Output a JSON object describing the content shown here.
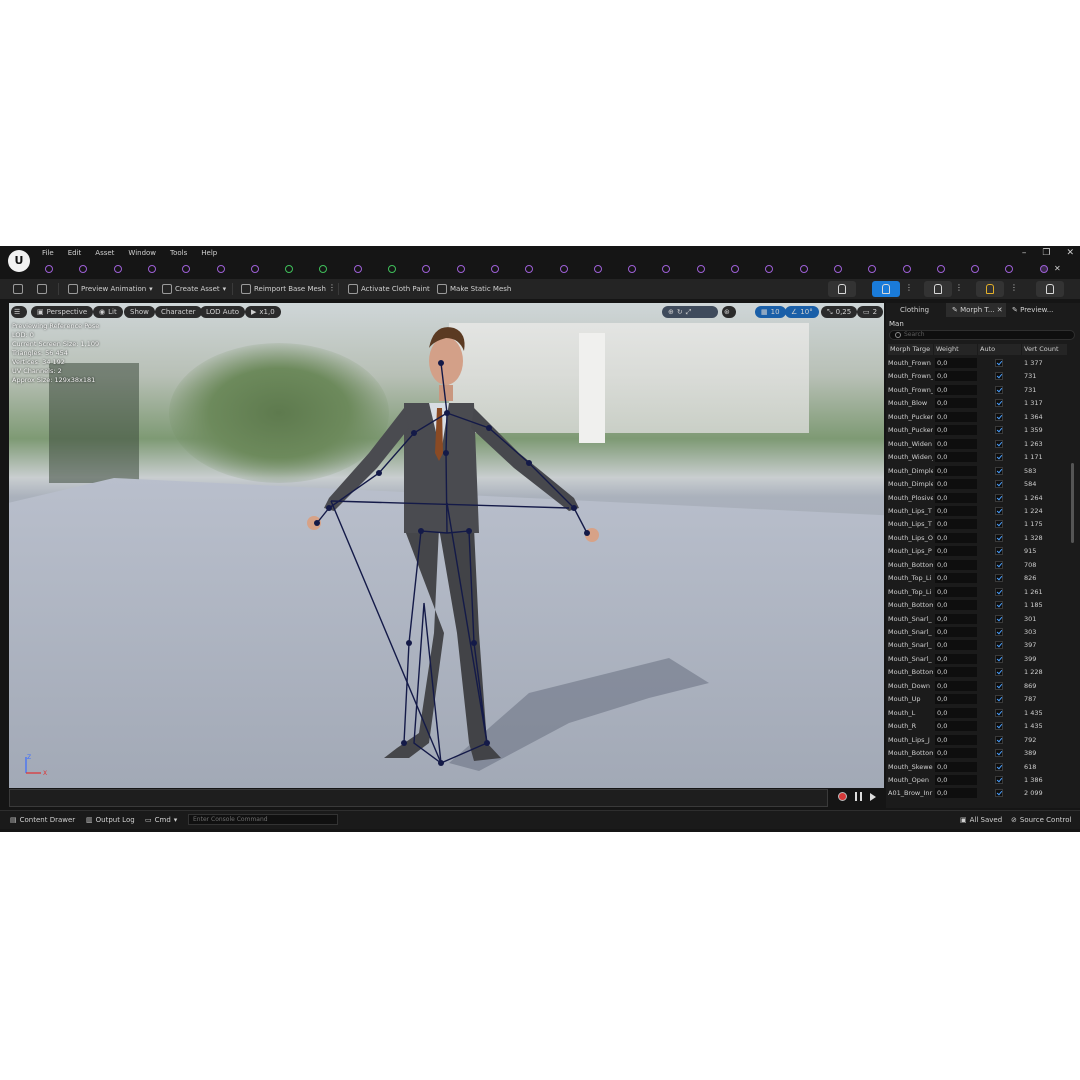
{
  "menu": {
    "items": [
      "File",
      "Edit",
      "Asset",
      "Window",
      "Tools",
      "Help"
    ]
  },
  "window_controls": {
    "minimize": "–",
    "maximize": "❐",
    "close": "✕"
  },
  "toolbar": {
    "preview_animation": "Preview Animation",
    "create_asset": "Create Asset",
    "reimport_base_mesh": "Reimport Base Mesh",
    "activate_cloth_paint": "Activate Cloth Paint",
    "make_static_mesh": "Make Static Mesh",
    "accent_color": "#1a7bd9"
  },
  "viewport": {
    "perspective": "Perspective",
    "lit": "Lit",
    "show": "Show",
    "character": "Character",
    "lod_auto": "LOD Auto",
    "play_rate": "x1,0",
    "grid_snap": "10",
    "rot_snap": "10°",
    "scale_snap": "0,25",
    "camera_speed": "2",
    "stats": [
      "Previewing Reference Pose",
      "LOD: 0",
      "Current Screen Size: 1,109",
      "Triangles: 56 454",
      "Vertices: 34 192",
      "UV Channels: 2",
      "Approx Size: 129x38x181"
    ],
    "axis_z": "Z",
    "axis_x": "X"
  },
  "statusbar": {
    "content_drawer": "Content Drawer",
    "output_log": "Output Log",
    "cmd": "Cmd",
    "console_placeholder": "Enter Console Command",
    "all_saved": "All Saved",
    "source_control": "Source Control"
  },
  "panel": {
    "tabs": [
      "Clothing",
      "Morph T...",
      "Preview..."
    ],
    "asset_name": "Man",
    "search_placeholder": "Search",
    "columns": [
      "Morph Targe",
      "Weight",
      "Auto",
      "Vert Count"
    ],
    "rows": [
      {
        "name": "Mouth_Frown",
        "weight": "0,0",
        "vert": "1 377"
      },
      {
        "name": "Mouth_Frown_",
        "weight": "0,0",
        "vert": "731"
      },
      {
        "name": "Mouth_Frown_",
        "weight": "0,0",
        "vert": "731"
      },
      {
        "name": "Mouth_Blow",
        "weight": "0,0",
        "vert": "1 317"
      },
      {
        "name": "Mouth_Pucker",
        "weight": "0,0",
        "vert": "1 364"
      },
      {
        "name": "Mouth_Pucker",
        "weight": "0,0",
        "vert": "1 359"
      },
      {
        "name": "Mouth_Widen",
        "weight": "0,0",
        "vert": "1 263"
      },
      {
        "name": "Mouth_Widen_",
        "weight": "0,0",
        "vert": "1 171"
      },
      {
        "name": "Mouth_Dimple",
        "weight": "0,0",
        "vert": "583"
      },
      {
        "name": "Mouth_Dimple",
        "weight": "0,0",
        "vert": "584"
      },
      {
        "name": "Mouth_Plosive",
        "weight": "0,0",
        "vert": "1 264"
      },
      {
        "name": "Mouth_Lips_T",
        "weight": "0,0",
        "vert": "1 224"
      },
      {
        "name": "Mouth_Lips_T",
        "weight": "0,0",
        "vert": "1 175"
      },
      {
        "name": "Mouth_Lips_O",
        "weight": "0,0",
        "vert": "1 328"
      },
      {
        "name": "Mouth_Lips_P",
        "weight": "0,0",
        "vert": "915"
      },
      {
        "name": "Mouth_Bottom",
        "weight": "0,0",
        "vert": "708"
      },
      {
        "name": "Mouth_Top_Li",
        "weight": "0,0",
        "vert": "826"
      },
      {
        "name": "Mouth_Top_Li",
        "weight": "0,0",
        "vert": "1 261"
      },
      {
        "name": "Mouth_Bottom",
        "weight": "0,0",
        "vert": "1 185"
      },
      {
        "name": "Mouth_Snarl_",
        "weight": "0,0",
        "vert": "301"
      },
      {
        "name": "Mouth_Snarl_",
        "weight": "0,0",
        "vert": "303"
      },
      {
        "name": "Mouth_Snarl_",
        "weight": "0,0",
        "vert": "397"
      },
      {
        "name": "Mouth_Snarl_",
        "weight": "0,0",
        "vert": "399"
      },
      {
        "name": "Mouth_Bottom",
        "weight": "0,0",
        "vert": "1 228"
      },
      {
        "name": "Mouth_Down",
        "weight": "0,0",
        "vert": "869"
      },
      {
        "name": "Mouth_Up",
        "weight": "0,0",
        "vert": "787"
      },
      {
        "name": "Mouth_L",
        "weight": "0,0",
        "vert": "1 435"
      },
      {
        "name": "Mouth_R",
        "weight": "0,0",
        "vert": "1 435"
      },
      {
        "name": "Mouth_Lips_J",
        "weight": "0,0",
        "vert": "792"
      },
      {
        "name": "Mouth_Bottom",
        "weight": "0,0",
        "vert": "389"
      },
      {
        "name": "Mouth_Skewe",
        "weight": "0,0",
        "vert": "618"
      },
      {
        "name": "Mouth_Open",
        "weight": "0,0",
        "vert": "1 386"
      },
      {
        "name": "A01_Brow_Inr",
        "weight": "0,0",
        "vert": "2 099"
      }
    ]
  }
}
